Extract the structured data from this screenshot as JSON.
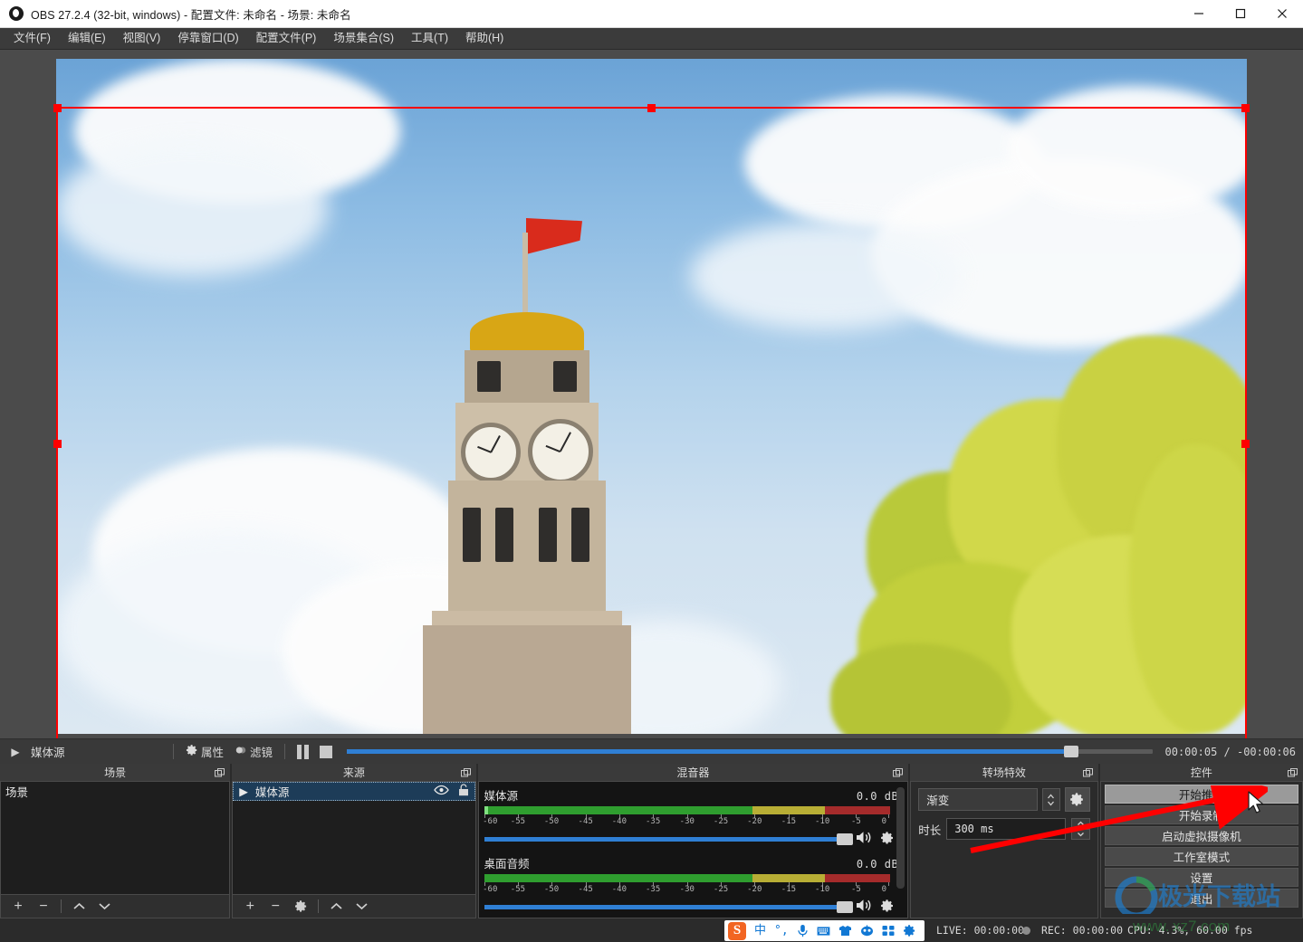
{
  "window": {
    "title_app": "OBS 27.2.4 (32-bit, windows)",
    "title_sep1": " - ",
    "title_profile": "配置文件: 未命名",
    "title_sep2": " - ",
    "title_scene": "场景: 未命名",
    "full_title": "OBS 27.2.4 (32-bit, windows) - 配置文件: 未命名 - 场景: 未命名",
    "minimize": "—",
    "maximize": "□",
    "close": "✕"
  },
  "menubar": {
    "items": [
      {
        "label": "文件(F)"
      },
      {
        "label": "编辑(E)"
      },
      {
        "label": "视图(V)"
      },
      {
        "label": "停靠窗口(D)"
      },
      {
        "label": "配置文件(P)"
      },
      {
        "label": "场景集合(S)"
      },
      {
        "label": "工具(T)"
      },
      {
        "label": "帮助(H)"
      }
    ]
  },
  "media_controls": {
    "source_name": "媒体源",
    "properties_label": "属性",
    "filters_label": "滤镜",
    "time_current": "00:00:05",
    "time_separator": "/",
    "time_remaining": "-00:00:06",
    "timecode": "00:00:05 / -00:00:06",
    "progress_percent": 89
  },
  "scenes_dock": {
    "title": "场景",
    "items": [
      {
        "name": "场景",
        "selected": true
      }
    ],
    "toolbar": [
      {
        "icon": "plus-icon",
        "label": "+"
      },
      {
        "icon": "minus-icon",
        "label": "−"
      },
      {
        "icon": "chevron-up-icon",
        "label": "⌃"
      },
      {
        "icon": "chevron-down-icon",
        "label": "⌄"
      }
    ]
  },
  "sources_dock": {
    "title": "来源",
    "items": [
      {
        "name": "媒体源",
        "selected": true,
        "visible": true,
        "locked": false
      }
    ],
    "toolbar": [
      {
        "icon": "plus-icon",
        "label": "+"
      },
      {
        "icon": "minus-icon",
        "label": "−"
      },
      {
        "icon": "gear-icon",
        "label": "⚙"
      },
      {
        "icon": "chevron-up-icon",
        "label": "⌃"
      },
      {
        "icon": "chevron-down-icon",
        "label": "⌄"
      }
    ]
  },
  "mixer_dock": {
    "title": "混音器",
    "scale_labels": [
      "-60",
      "-55",
      "-50",
      "-45",
      "-40",
      "-35",
      "-30",
      "-25",
      "-20",
      "-15",
      "-10",
      "-5",
      "0"
    ],
    "channels": [
      {
        "name": "媒体源",
        "db": "0.0",
        "db_unit": "dB",
        "volume_percent": 97
      },
      {
        "name": "桌面音频",
        "db": "0.0",
        "db_unit": "dB",
        "volume_percent": 97
      }
    ]
  },
  "transitions_dock": {
    "title": "转场特效",
    "selected_transition": "渐变",
    "duration_label": "时长",
    "duration_value": "300 ms"
  },
  "controls_dock": {
    "title": "控件",
    "buttons": [
      {
        "label": "开始推流",
        "hover": true
      },
      {
        "label": "开始录制",
        "hover": false
      },
      {
        "label": "启动虚拟摄像机",
        "hover": false
      },
      {
        "label": "工作室模式",
        "hover": false
      },
      {
        "label": "设置",
        "hover": false
      },
      {
        "label": "退出",
        "hover": false
      }
    ]
  },
  "statusbar": {
    "live_label": "LIVE:",
    "live_time": "00:00:00",
    "rec_label": "REC:",
    "rec_time": "00:00:00",
    "cpu_label": "CPU:",
    "cpu_value": "4.3%,",
    "fps_value": "60.00 fps",
    "full_right": "CPU: 4.3%, 60.00 fps",
    "ime_lang": "中",
    "ime_punct": "°,"
  },
  "watermark": {
    "site_cn": "极光下载站",
    "site_url": "www.xz7.com"
  },
  "colors": {
    "accent_blue": "#2f7fd4",
    "selection_red": "#ff0000",
    "meter_green": "#2f9e2f",
    "meter_yellow": "#b8ae35",
    "meter_red": "#a52b2b",
    "panel_bg": "#2b2b2b",
    "dock_header": "#3a3a3a"
  }
}
